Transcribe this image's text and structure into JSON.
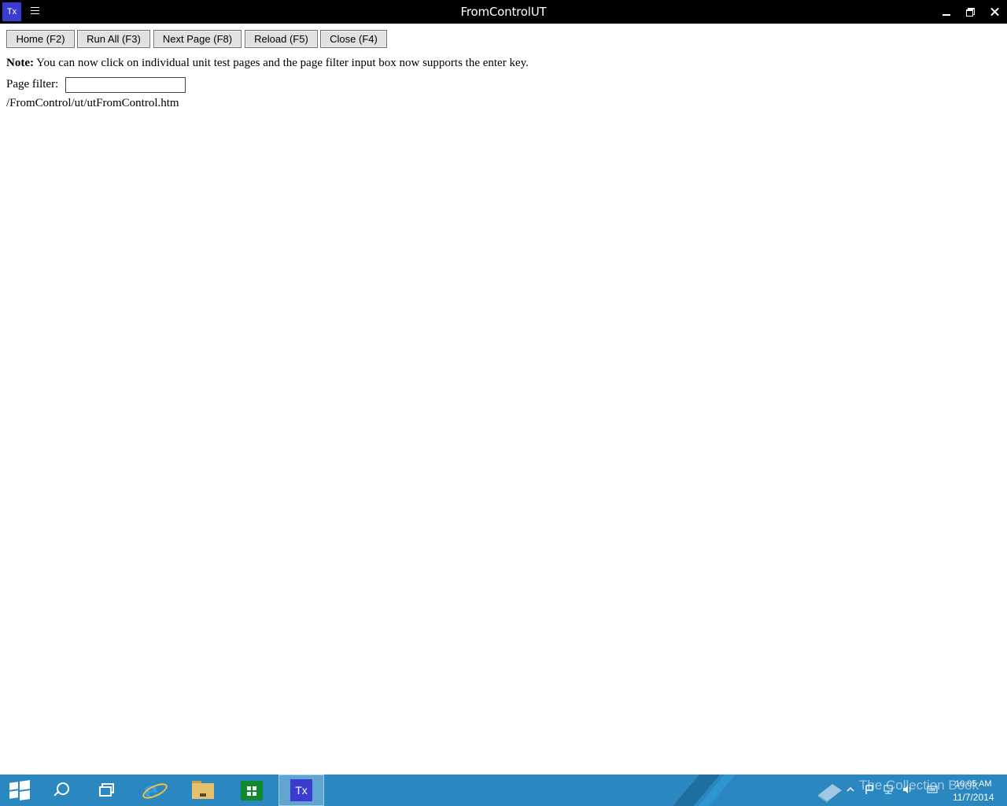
{
  "window": {
    "app_icon_label": "Tx",
    "title": "FromControlUT",
    "menu_icon": "hamburger-menu-icon",
    "controls": [
      "minimize-icon",
      "restore-icon",
      "close-icon"
    ]
  },
  "toolbar": {
    "home_label": "Home (F2)",
    "run_all_label": "Run All (F3)",
    "next_page_label": "Next Page (F8)",
    "reload_label": "Reload (F5)",
    "close_label": "Close (F4)"
  },
  "note": {
    "prefix": "Note:",
    "text": " You can now click on individual unit test pages and the page filter input box now supports the enter key."
  },
  "filter": {
    "label": "Page filter:",
    "value": ""
  },
  "pages": [
    "/FromControl/ut/utFromControl.htm"
  ],
  "taskbar": {
    "items": [
      "start-icon",
      "search-icon",
      "task-view-icon",
      "internet-explorer-icon",
      "file-explorer-icon",
      "store-icon"
    ],
    "active_app_label": "Tx",
    "watermark": "The Collection Book",
    "clock_time": "10:05 AM",
    "clock_date": "11/7/2014",
    "colors": {
      "taskbar": "#2a87bf",
      "app_icon": "#3b3bd1",
      "titlebar": "#000000"
    }
  }
}
